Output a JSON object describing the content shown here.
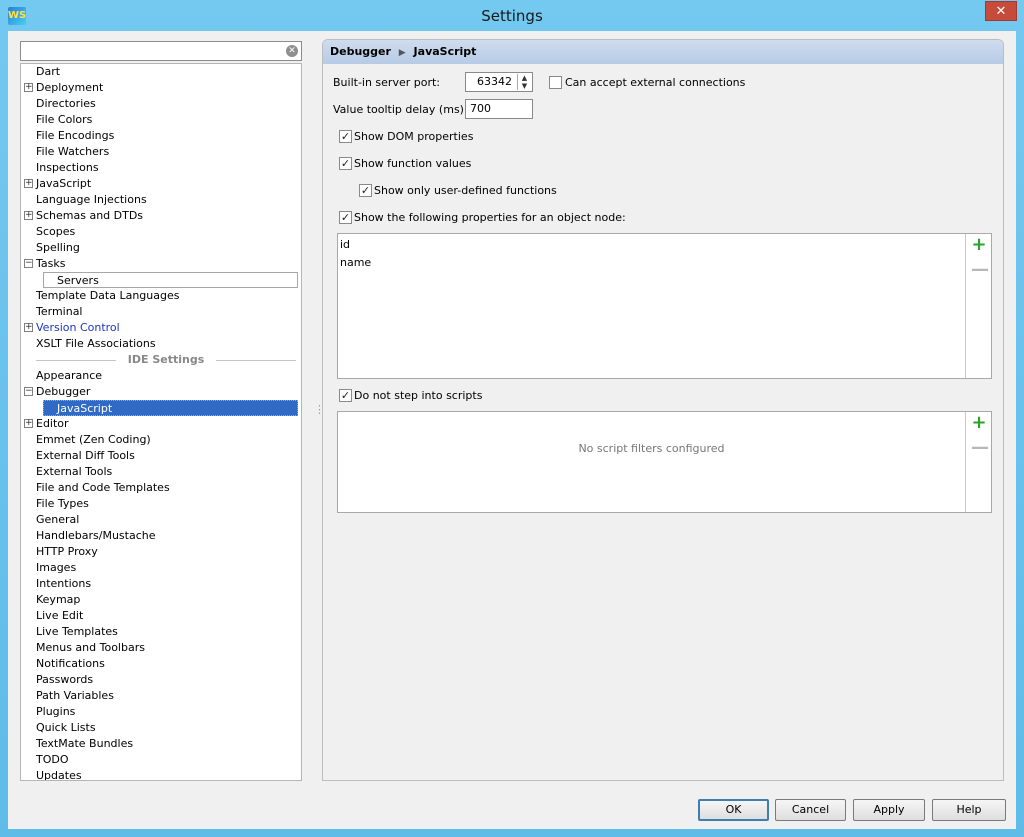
{
  "window": {
    "title": "Settings",
    "app_icon": "WS",
    "close_symbol": "✕"
  },
  "search": {
    "value": "",
    "clear_icon": "clear-icon"
  },
  "tree": {
    "project_items": [
      {
        "label": "Dart",
        "expandable": false
      },
      {
        "label": "Deployment",
        "expandable": true
      },
      {
        "label": "Directories",
        "expandable": false
      },
      {
        "label": "File Colors",
        "expandable": false
      },
      {
        "label": "File Encodings",
        "expandable": false
      },
      {
        "label": "File Watchers",
        "expandable": false
      },
      {
        "label": "Inspections",
        "expandable": false
      },
      {
        "label": "JavaScript",
        "expandable": true
      },
      {
        "label": "Language Injections",
        "expandable": false
      },
      {
        "label": "Schemas and DTDs",
        "expandable": true
      },
      {
        "label": "Scopes",
        "expandable": false
      },
      {
        "label": "Spelling",
        "expandable": false
      },
      {
        "label": "Tasks",
        "expandable": true,
        "expanded": true
      },
      {
        "label": "Servers",
        "child": true
      },
      {
        "label": "Template Data Languages",
        "expandable": false
      },
      {
        "label": "Terminal",
        "expandable": false
      },
      {
        "label": "Version Control",
        "expandable": true,
        "link": true
      },
      {
        "label": "XSLT File Associations",
        "expandable": false
      }
    ],
    "ide_header": "IDE Settings",
    "ide_items": [
      {
        "label": "Appearance"
      },
      {
        "label": "Debugger",
        "expandable": true,
        "expanded": true
      },
      {
        "label": "JavaScript",
        "child": true,
        "selected": true
      },
      {
        "label": "Editor",
        "expandable": true
      },
      {
        "label": "Emmet (Zen Coding)"
      },
      {
        "label": "External Diff Tools"
      },
      {
        "label": "External Tools"
      },
      {
        "label": "File and Code Templates"
      },
      {
        "label": "File Types"
      },
      {
        "label": "General"
      },
      {
        "label": "Handlebars/Mustache"
      },
      {
        "label": "HTTP Proxy"
      },
      {
        "label": "Images"
      },
      {
        "label": "Intentions"
      },
      {
        "label": "Keymap"
      },
      {
        "label": "Live Edit"
      },
      {
        "label": "Live Templates"
      },
      {
        "label": "Menus and Toolbars"
      },
      {
        "label": "Notifications"
      },
      {
        "label": "Passwords"
      },
      {
        "label": "Path Variables"
      },
      {
        "label": "Plugins"
      },
      {
        "label": "Quick Lists"
      },
      {
        "label": "TextMate Bundles"
      },
      {
        "label": "TODO"
      },
      {
        "label": "Updates"
      }
    ]
  },
  "breadcrumb": {
    "parent": "Debugger",
    "sep": "▶",
    "current": "JavaScript"
  },
  "settings": {
    "port_label": "Built-in server port:",
    "port_value": "63342",
    "spin_symbol": "▲▼",
    "external_label": "Can accept external connections",
    "external_checked": false,
    "tooltip_label": "Value tooltip delay (ms):",
    "tooltip_value": "700",
    "show_dom_label": "Show DOM properties",
    "show_dom_checked": true,
    "show_func_label": "Show function values",
    "show_func_checked": true,
    "user_defined_label": "Show only user-defined functions",
    "user_defined_checked": true,
    "show_props_label": "Show the following properties for an object node:",
    "show_props_checked": true,
    "properties": [
      "id",
      "name"
    ],
    "no_step_label": "Do not step into scripts",
    "no_step_checked": true,
    "filters_empty": "No script filters configured",
    "check_mark": "✓",
    "plus_symbol": "+",
    "minus_symbol": "—"
  },
  "buttons": {
    "ok": "OK",
    "cancel": "Cancel",
    "apply": "Apply",
    "help": "Help"
  }
}
